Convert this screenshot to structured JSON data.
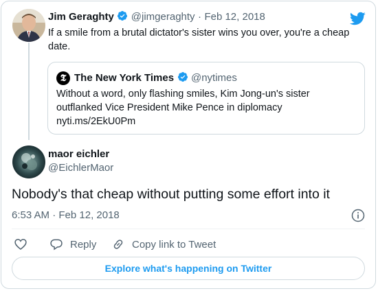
{
  "parent_tweet": {
    "author_name": "Jim Geraghty",
    "handle": "@jimgeraghty",
    "separator": "·",
    "date": "Feb 12, 2018",
    "text_line1": "If a smile from a brutal dictator's sister wins you over, you're a cheap",
    "text_line2": "date."
  },
  "quoted_tweet": {
    "author_name": "The New York Times",
    "handle": "@nytimes",
    "text_line1": "Without a word, only flashing smiles, Kim Jong-un's sister",
    "text_line2": "outflanked Vice President Mike Pence in diplomacy",
    "link": "nyti.ms/2EkU0Pm"
  },
  "main_tweet": {
    "author_name": "maor eichler",
    "handle": "@EichlerMaor",
    "text": "Nobody's that cheap without putting some effort into it",
    "timestamp": "6:53 AM · Feb 12, 2018"
  },
  "actions": {
    "reply_label": "Reply",
    "copy_link_label": "Copy link to Tweet"
  },
  "explore_label": "Explore what's happening on Twitter",
  "colors": {
    "accent": "#1d9bf0",
    "text": "#0f1419",
    "muted": "#536471",
    "border": "#cfd9de"
  },
  "icons": [
    "twitter-bird-icon",
    "verified-badge-icon",
    "nyt-logo-icon",
    "info-icon",
    "heart-icon",
    "reply-icon",
    "link-icon"
  ]
}
